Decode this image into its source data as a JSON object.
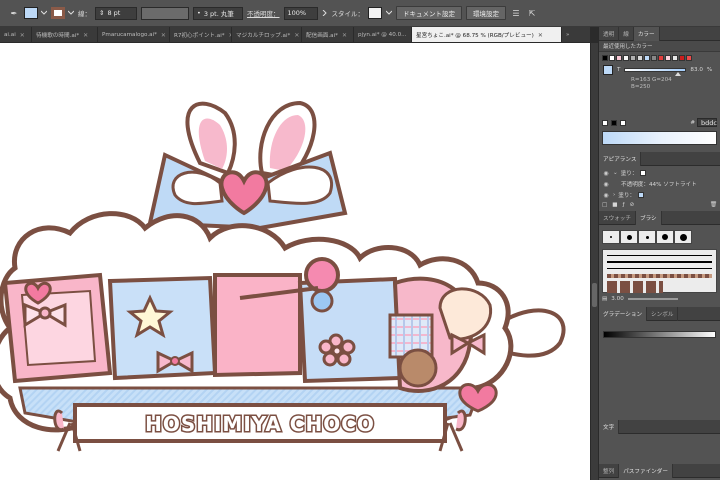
{
  "control_bar": {
    "stroke_label": "線：",
    "stroke_weight": "8 pt",
    "brush_label": "3 pt. 丸筆",
    "opacity_label": "不透明度：",
    "opacity_value": "100%",
    "style_label": "スタイル：",
    "doc_settings": "ドキュメント設定",
    "preferences": "環境設定",
    "fill_color": "#bdd9f7",
    "stroke_color": "#8a5a48"
  },
  "tabs": [
    {
      "label": "ai.ai"
    },
    {
      "label": "待機歌の時間.ai*"
    },
    {
      "label": "Pmarucamalogo.ai*"
    },
    {
      "label": "R7初心ポイント.ai*"
    },
    {
      "label": "マジカルチロップ.ai*"
    },
    {
      "label": "配信画面.ai*"
    },
    {
      "label": "pjyn.ai* @ 40.0..."
    },
    {
      "label": "星宮ちょこ.ai* @ 68.75 % (RGB/プレビュー)",
      "active": true
    }
  ],
  "logo": {
    "title": "HOSHIMIYA CHOCO"
  },
  "panels": {
    "top_tabs": [
      "透明",
      "線",
      "カラー"
    ],
    "recent_colors_label": "最近使用したカラー",
    "tint_label": "T",
    "tint_value": "83.0",
    "tint_unit": "%",
    "rgb_readout": "R=163 G=204",
    "rgb_readout2": "B=250",
    "hex_value": "bddc",
    "appearance_tab": "アピアランス",
    "fill_label": "塗り：",
    "opacity_row": "不透明度：44% ソフトライト",
    "fill_label2": "塗り：",
    "swatches_tab": "スウォッチ",
    "brush_tab": "ブラシ",
    "brush_size": "3.00",
    "gradient_tab": "グラデーション",
    "symbol_tab": "シンボル",
    "text_tab": "文字",
    "align_tab": "整列",
    "pathfinder_tab": "パスファインダー"
  }
}
